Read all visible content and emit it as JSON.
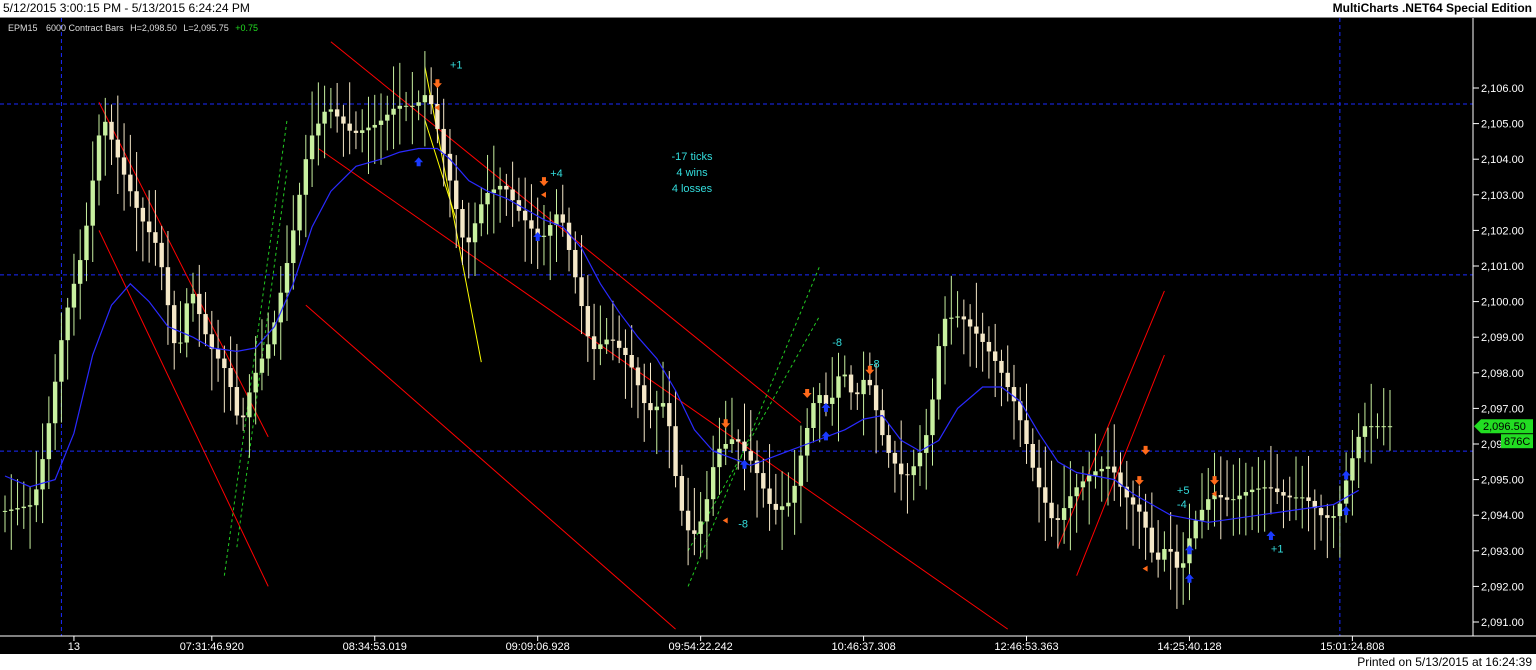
{
  "window": {
    "range_text": "5/12/2015 3:00:15 PM - 5/13/2015 6:24:24 PM",
    "edition_text": "MultiCharts .NET64 Special Edition",
    "printed_text": "Printed on 5/13/2015 at 16:24:39"
  },
  "colors": {
    "background": "#000000",
    "bar": "#f5e8c8",
    "bar_bull": "#c8f0a0",
    "moving_average": "#2a2aff",
    "channel": "#ff0000",
    "trend_dashed": "#22cc22",
    "trend_yellow": "#ffff00",
    "annotation": "#33dddd",
    "sell_arrow": "#ff6a1a",
    "buy_arrow": "#1a3aff",
    "price_tag": "#22dd22",
    "grid_dashed": "#1a2aff"
  },
  "chart_data": {
    "type": "candlestick",
    "header": {
      "symbol": "EPM15",
      "bars": "6000 Contract Bars",
      "high": "H=2,098.50",
      "low": "L=2,095.75",
      "change": "+0.75"
    },
    "y_axis": {
      "ylim": [
        2090.75,
        2107.7
      ],
      "ticks": [
        "2,106.00",
        "2,105.00",
        "2,104.00",
        "2,103.00",
        "2,102.00",
        "2,101.00",
        "2,100.00",
        "2,099.00",
        "2,098.00",
        "2,097.00",
        "2,096.00",
        "2,095.00",
        "2,094.00",
        "2,093.00",
        "2,092.00",
        "2,091.00"
      ],
      "last_price_label": "2,096.50",
      "last_price": 2096.5,
      "volume_label": "876C"
    },
    "x_axis": {
      "ticks": [
        {
          "label": "13",
          "bar": 11
        },
        {
          "label": "07:31:46.920",
          "bar": 33
        },
        {
          "label": "08:34:53.019",
          "bar": 59
        },
        {
          "label": "09:09:06.928",
          "bar": 85
        },
        {
          "label": "09:54:22.242",
          "bar": 111
        },
        {
          "label": "10:46:37.308",
          "bar": 137
        },
        {
          "label": "12:46:53.363",
          "bar": 163
        },
        {
          "label": "14:25:40.128",
          "bar": 189
        },
        {
          "label": "15:01:24.808",
          "bar": 215
        }
      ]
    },
    "bar_count": 222,
    "close_path": [
      [
        0,
        2094.1
      ],
      [
        5,
        2094.3
      ],
      [
        7,
        2096.0
      ],
      [
        10,
        2099.5
      ],
      [
        13,
        2101.5
      ],
      [
        16,
        2105.3
      ],
      [
        19,
        2103.8
      ],
      [
        22,
        2102.4
      ],
      [
        25,
        2101.5
      ],
      [
        28,
        2098.3
      ],
      [
        30,
        2100.5
      ],
      [
        33,
        2098.8
      ],
      [
        36,
        2098.0
      ],
      [
        38,
        2096.4
      ],
      [
        40,
        2097.8
      ],
      [
        43,
        2099.0
      ],
      [
        46,
        2101.5
      ],
      [
        49,
        2104.5
      ],
      [
        52,
        2105.5
      ],
      [
        56,
        2104.7
      ],
      [
        60,
        2105.0
      ],
      [
        63,
        2105.5
      ],
      [
        66,
        2105.5
      ],
      [
        68,
        2105.9
      ],
      [
        71,
        2103.8
      ],
      [
        74,
        2101.4
      ],
      [
        77,
        2103.0
      ],
      [
        80,
        2103.3
      ],
      [
        83,
        2102.4
      ],
      [
        86,
        2101.7
      ],
      [
        89,
        2102.6
      ],
      [
        92,
        2100.3
      ],
      [
        94,
        2098.6
      ],
      [
        97,
        2099.0
      ],
      [
        100,
        2098.4
      ],
      [
        103,
        2096.9
      ],
      [
        106,
        2097.2
      ],
      [
        108,
        2094.4
      ],
      [
        110,
        2093.3
      ],
      [
        112,
        2094.0
      ],
      [
        114,
        2095.8
      ],
      [
        117,
        2096.2
      ],
      [
        120,
        2095.4
      ],
      [
        123,
        2094.1
      ],
      [
        126,
        2094.4
      ],
      [
        128,
        2096.1
      ],
      [
        130,
        2097.5
      ],
      [
        132,
        2097.0
      ],
      [
        134,
        2098.2
      ],
      [
        136,
        2097.2
      ],
      [
        138,
        2098.0
      ],
      [
        141,
        2095.9
      ],
      [
        144,
        2095.0
      ],
      [
        146,
        2095.5
      ],
      [
        148,
        2096.5
      ],
      [
        150,
        2099.5
      ],
      [
        153,
        2099.6
      ],
      [
        156,
        2099.0
      ],
      [
        159,
        2098.2
      ],
      [
        162,
        2097.0
      ],
      [
        165,
        2095.0
      ],
      [
        168,
        2093.7
      ],
      [
        171,
        2094.7
      ],
      [
        174,
        2095.2
      ],
      [
        177,
        2095.4
      ],
      [
        179,
        2094.6
      ],
      [
        182,
        2094.0
      ],
      [
        184,
        2092.6
      ],
      [
        186,
        2093.2
      ],
      [
        188,
        2092.3
      ],
      [
        190,
        2093.7
      ],
      [
        193,
        2094.6
      ],
      [
        196,
        2094.4
      ],
      [
        199,
        2094.7
      ],
      [
        202,
        2094.8
      ],
      [
        205,
        2094.5
      ],
      [
        208,
        2094.5
      ],
      [
        211,
        2093.9
      ],
      [
        213,
        2094.0
      ],
      [
        215,
        2095.3
      ],
      [
        217,
        2096.5
      ]
    ],
    "moving_average_path": [
      [
        0,
        2095.1
      ],
      [
        4,
        2094.8
      ],
      [
        8,
        2095.0
      ],
      [
        11,
        2096.3
      ],
      [
        14,
        2098.5
      ],
      [
        17,
        2099.9
      ],
      [
        20,
        2100.5
      ],
      [
        23,
        2100.0
      ],
      [
        26,
        2099.3
      ],
      [
        30,
        2099.0
      ],
      [
        33,
        2098.7
      ],
      [
        37,
        2098.6
      ],
      [
        40,
        2098.7
      ],
      [
        43,
        2099.3
      ],
      [
        46,
        2100.5
      ],
      [
        49,
        2102.1
      ],
      [
        52,
        2103.1
      ],
      [
        56,
        2103.8
      ],
      [
        60,
        2104.0
      ],
      [
        63,
        2104.2
      ],
      [
        66,
        2104.3
      ],
      [
        69,
        2104.3
      ],
      [
        71,
        2104.0
      ],
      [
        74,
        2103.4
      ],
      [
        77,
        2103.1
      ],
      [
        80,
        2102.9
      ],
      [
        83,
        2102.6
      ],
      [
        86,
        2102.3
      ],
      [
        89,
        2102.1
      ],
      [
        92,
        2101.5
      ],
      [
        95,
        2100.5
      ],
      [
        98,
        2099.7
      ],
      [
        101,
        2099.0
      ],
      [
        104,
        2098.4
      ],
      [
        107,
        2097.5
      ],
      [
        110,
        2096.4
      ],
      [
        113,
        2095.8
      ],
      [
        116,
        2095.6
      ],
      [
        119,
        2095.4
      ],
      [
        122,
        2095.6
      ],
      [
        125,
        2095.8
      ],
      [
        128,
        2096.0
      ],
      [
        131,
        2096.2
      ],
      [
        134,
        2096.4
      ],
      [
        137,
        2096.7
      ],
      [
        140,
        2096.8
      ],
      [
        143,
        2096.1
      ],
      [
        146,
        2095.8
      ],
      [
        149,
        2096.1
      ],
      [
        152,
        2097.0
      ],
      [
        156,
        2097.6
      ],
      [
        159,
        2097.6
      ],
      [
        162,
        2097.2
      ],
      [
        165,
        2096.3
      ],
      [
        168,
        2095.5
      ],
      [
        171,
        2095.2
      ],
      [
        174,
        2095.1
      ],
      [
        177,
        2095.0
      ],
      [
        180,
        2094.6
      ],
      [
        183,
        2094.3
      ],
      [
        186,
        2094.0
      ],
      [
        189,
        2093.9
      ],
      [
        192,
        2093.8
      ],
      [
        196,
        2093.9
      ],
      [
        200,
        2094.0
      ],
      [
        204,
        2094.1
      ],
      [
        208,
        2094.2
      ],
      [
        212,
        2094.3
      ],
      [
        216,
        2094.7
      ]
    ],
    "horizontal_levels": [
      2105.55,
      2100.75,
      2095.8
    ],
    "vertical_markers_bars": [
      9,
      213
    ],
    "channels": [
      {
        "color": "red",
        "lines": [
          [
            [
              15,
              2105.6
            ],
            [
              42,
              2096.2
            ]
          ],
          [
            [
              15,
              2102.0
            ],
            [
              42,
              2092.0
            ]
          ]
        ]
      },
      {
        "color": "red",
        "lines": [
          [
            [
              52,
              2107.3
            ],
            [
              127,
              2096.6
            ]
          ],
          [
            [
              50,
              2104.3
            ],
            [
              160,
              2090.8
            ]
          ],
          [
            [
              48,
              2099.9
            ],
            [
              107,
              2090.8
            ]
          ]
        ]
      },
      {
        "color": "red",
        "lines": [
          [
            [
              168,
              2093.1
            ],
            [
              185,
              2100.3
            ]
          ],
          [
            [
              171,
              2092.3
            ],
            [
              185,
              2098.5
            ]
          ]
        ]
      },
      {
        "color": "yellow",
        "lines": [
          [
            [
              67,
              2106.6
            ],
            [
              76,
              2098.3
            ]
          ],
          [
            [
              67,
              2105.1
            ],
            [
              72,
              2102.3
            ]
          ]
        ]
      },
      {
        "color": "green-dashed",
        "lines": [
          [
            [
              35,
              2092.3
            ],
            [
              45,
              2105.1
            ]
          ],
          [
            [
              37,
              2093.1
            ],
            [
              45,
              2103.7
            ]
          ],
          [
            [
              109,
              2092.0
            ],
            [
              130,
              2101.0
            ]
          ],
          [
            [
              109,
              2093.0
            ],
            [
              130,
              2099.6
            ]
          ]
        ]
      }
    ],
    "sell_signals": [
      [
        69,
        2106.05
      ],
      [
        86,
        2103.3
      ],
      [
        115,
        2096.5
      ],
      [
        128,
        2097.35
      ],
      [
        138,
        2098.0
      ],
      [
        182,
        2095.75
      ],
      [
        181,
        2094.9
      ],
      [
        193,
        2094.9
      ]
    ],
    "buy_signals": [
      [
        66,
        2104.0
      ],
      [
        85,
        2101.9
      ],
      [
        118,
        2095.5
      ],
      [
        131,
        2097.1
      ],
      [
        131,
        2096.3
      ],
      [
        189,
        2093.1
      ],
      [
        189,
        2092.3
      ],
      [
        202,
        2093.5
      ],
      [
        214,
        2095.2
      ],
      [
        214,
        2094.2
      ]
    ],
    "exit_markers": [
      [
        69,
        2105.45
      ],
      [
        115,
        2093.85
      ],
      [
        86,
        2103.0
      ],
      [
        193,
        2094.6
      ],
      [
        182,
        2092.5
      ]
    ],
    "annotations": [
      {
        "text": "+1",
        "bar": 71,
        "price": 2106.55
      },
      {
        "text": "+4",
        "bar": 87,
        "price": 2103.5
      },
      {
        "text": "-8",
        "bar": 117,
        "price": 2093.65
      },
      {
        "text": "-8",
        "bar": 132,
        "price": 2098.75
      },
      {
        "text": "-8",
        "bar": 138,
        "price": 2098.15
      },
      {
        "text": "+5",
        "bar": 187,
        "price": 2094.6
      },
      {
        "text": "-4",
        "bar": 187,
        "price": 2094.2
      },
      {
        "text": "+1",
        "bar": 202,
        "price": 2092.95
      }
    ],
    "summary": {
      "lines": [
        "-17 ticks",
        "4 wins",
        "4 losses"
      ],
      "bar": 108,
      "price": 2104.0
    }
  }
}
